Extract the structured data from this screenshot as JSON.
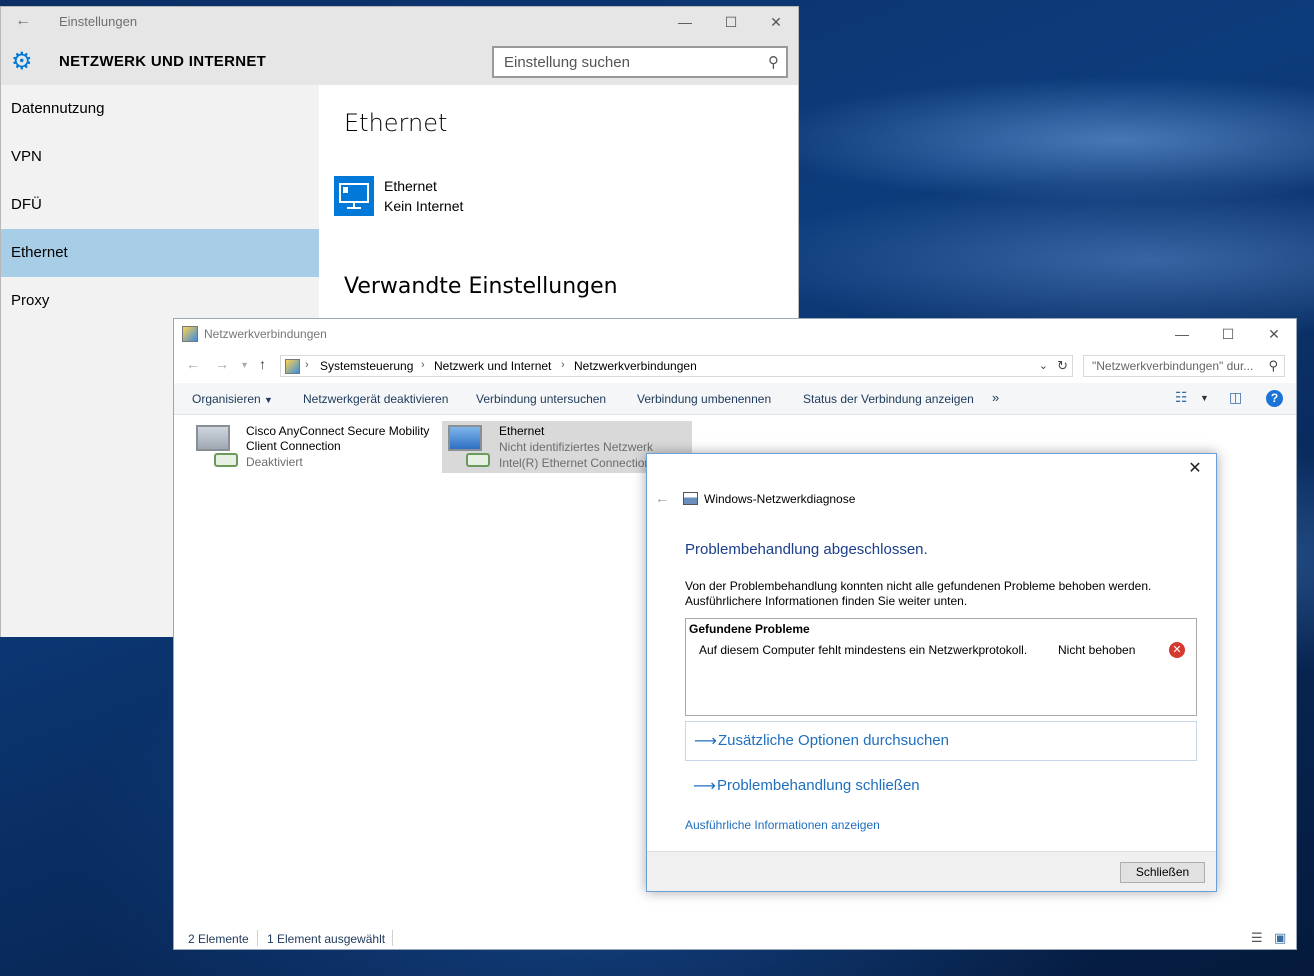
{
  "settings": {
    "window_title": "Einstellungen",
    "heading": "NETZWERK UND INTERNET",
    "search_placeholder": "Einstellung suchen",
    "nav_items": [
      {
        "label": "Datennutzung"
      },
      {
        "label": "VPN"
      },
      {
        "label": "DFÜ"
      },
      {
        "label": "Ethernet"
      },
      {
        "label": "Proxy"
      }
    ],
    "selected_nav": "Ethernet",
    "main_title": "Ethernet",
    "connection_name": "Ethernet",
    "connection_status": "Kein Internet",
    "related_title": "Verwandte Einstellungen"
  },
  "explorer": {
    "window_title": "Netzwerkverbindungen",
    "breadcrumbs": [
      "Systemsteuerung",
      "Netzwerk und Internet",
      "Netzwerkverbindungen"
    ],
    "search_placeholder": "\"Netzwerkverbindungen\" dur...",
    "toolbar": [
      "Organisieren",
      "Netzwerkgerät deaktivieren",
      "Verbindung untersuchen",
      "Verbindung umbenennen",
      "Status der Verbindung anzeigen"
    ],
    "items": [
      {
        "line1": "Cisco AnyConnect Secure Mobility",
        "line2": "Client Connection",
        "line3": "Deaktiviert"
      },
      {
        "line1": "Ethernet",
        "line2": "Nicht identifiziertes Netzwerk",
        "line3": "Intel(R) Ethernet Connection"
      }
    ],
    "status_count": "2 Elemente",
    "status_selected": "1 Element ausgewählt"
  },
  "dialog": {
    "app_title": "Windows-Netzwerkdiagnose",
    "heading": "Problembehandlung abgeschlossen.",
    "desc_line1": "Von der Problembehandlung konnten nicht alle gefundenen Probleme behoben werden.",
    "desc_line2": "Ausführlichere Informationen finden Sie weiter unten.",
    "problems_header": "Gefundene Probleme",
    "problem_text": "Auf diesem Computer fehlt mindestens ein Netzwerkprotokoll.",
    "problem_status": "Nicht behoben",
    "option1": "Zusätzliche Optionen durchsuchen",
    "option2": "Problembehandlung schließen",
    "details_link": "Ausführliche Informationen anzeigen",
    "close_button": "Schließen"
  },
  "colors": {
    "accent": "#0078d7",
    "selected_nav": "#a8cde6",
    "link": "#1f6fbf",
    "error": "#d43a2f"
  }
}
